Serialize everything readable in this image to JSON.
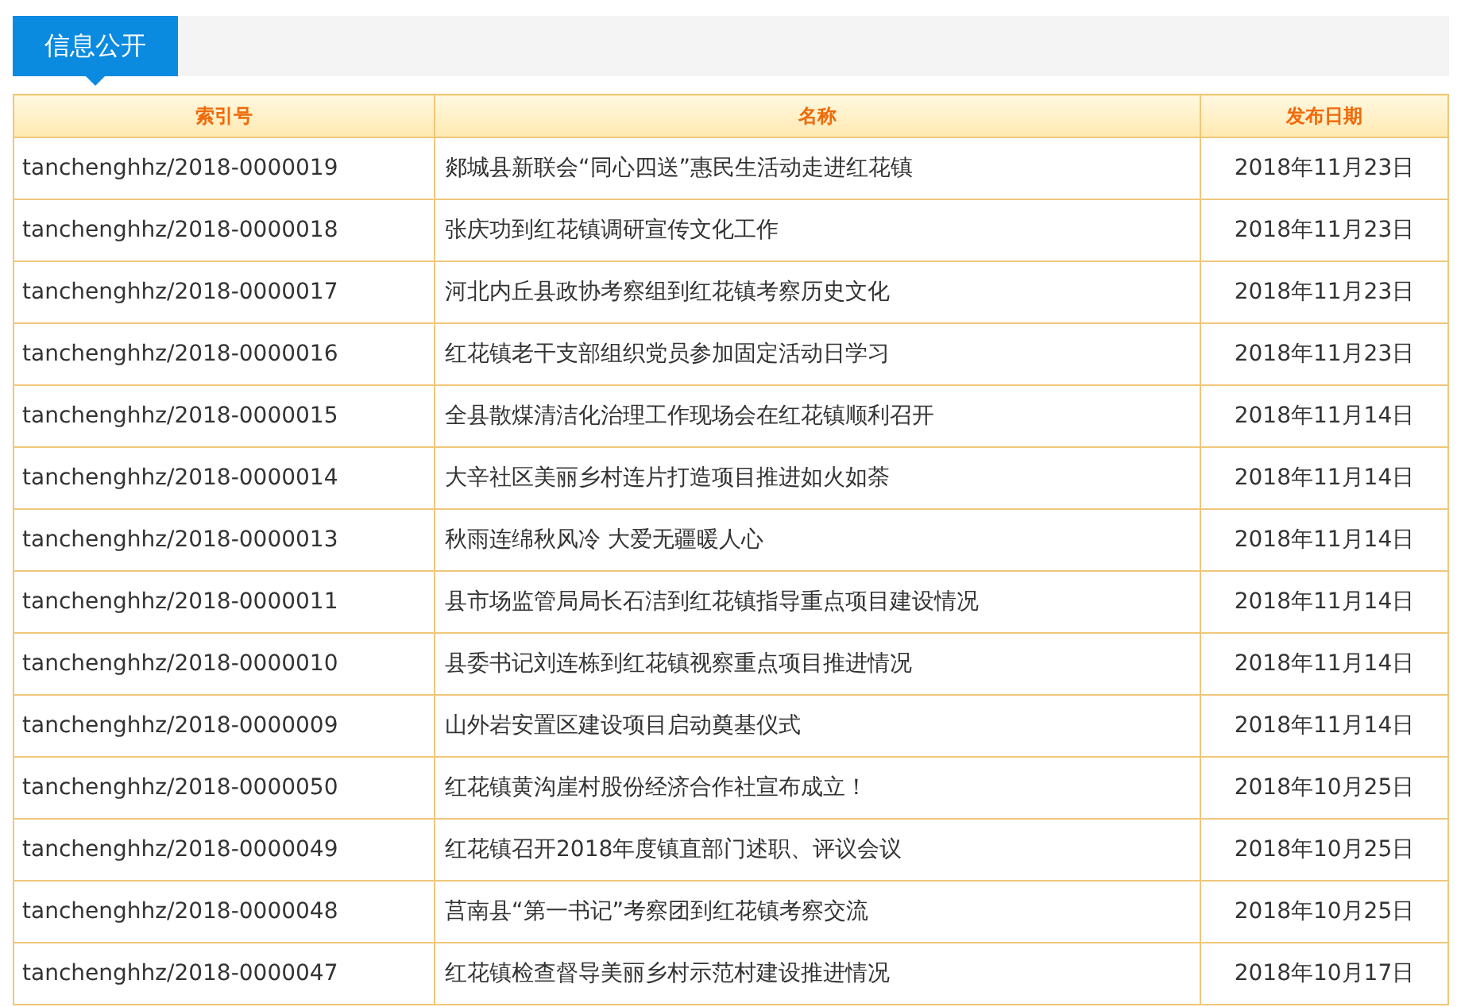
{
  "tabs": [
    {
      "label": "信息公开",
      "selected": true
    }
  ],
  "table": {
    "columns": [
      "索引号",
      "名称",
      "发布日期"
    ],
    "rows": [
      [
        "tanchenghhz/2018-0000019",
        "郯城县新联会“同心四送”惠民生活动走进红花镇",
        "2018年11月23日"
      ],
      [
        "tanchenghhz/2018-0000018",
        "张庆功到红花镇调研宣传文化工作",
        "2018年11月23日"
      ],
      [
        "tanchenghhz/2018-0000017",
        "河北内丘县政协考察组到红花镇考察历史文化",
        "2018年11月23日"
      ],
      [
        "tanchenghhz/2018-0000016",
        "红花镇老干支部组织党员参加固定活动日学习",
        "2018年11月23日"
      ],
      [
        "tanchenghhz/2018-0000015",
        "全县散煤清洁化治理工作现场会在红花镇顺利召开",
        "2018年11月14日"
      ],
      [
        "tanchenghhz/2018-0000014",
        "大辛社区美丽乡村连片打造项目推进如火如荼",
        "2018年11月14日"
      ],
      [
        "tanchenghhz/2018-0000013",
        "秋雨连绵秋风冷 大爱无疆暖人心",
        "2018年11月14日"
      ],
      [
        "tanchenghhz/2018-0000011",
        "县市场监管局局长石洁到红花镇指导重点项目建设情况",
        "2018年11月14日"
      ],
      [
        "tanchenghhz/2018-0000010",
        "县委书记刘连栋到红花镇视察重点项目推进情况",
        "2018年11月14日"
      ],
      [
        "tanchenghhz/2018-0000009",
        "山外岩安置区建设项目启动奠基仪式",
        "2018年11月14日"
      ],
      [
        "tanchenghhz/2018-0000050",
        "红花镇黄沟崖村股份经济合作社宣布成立！",
        "2018年10月25日"
      ],
      [
        "tanchenghhz/2018-0000049",
        "红花镇召开2018年度镇直部门述职、评议会议",
        "2018年10月25日"
      ],
      [
        "tanchenghhz/2018-0000048",
        "莒南县“第一书记”考察团到红花镇考察交流",
        "2018年10月25日"
      ],
      [
        "tanchenghhz/2018-0000047",
        "红花镇检查督导美丽乡村示范村建设推进情况",
        "2018年10月17日"
      ]
    ]
  }
}
